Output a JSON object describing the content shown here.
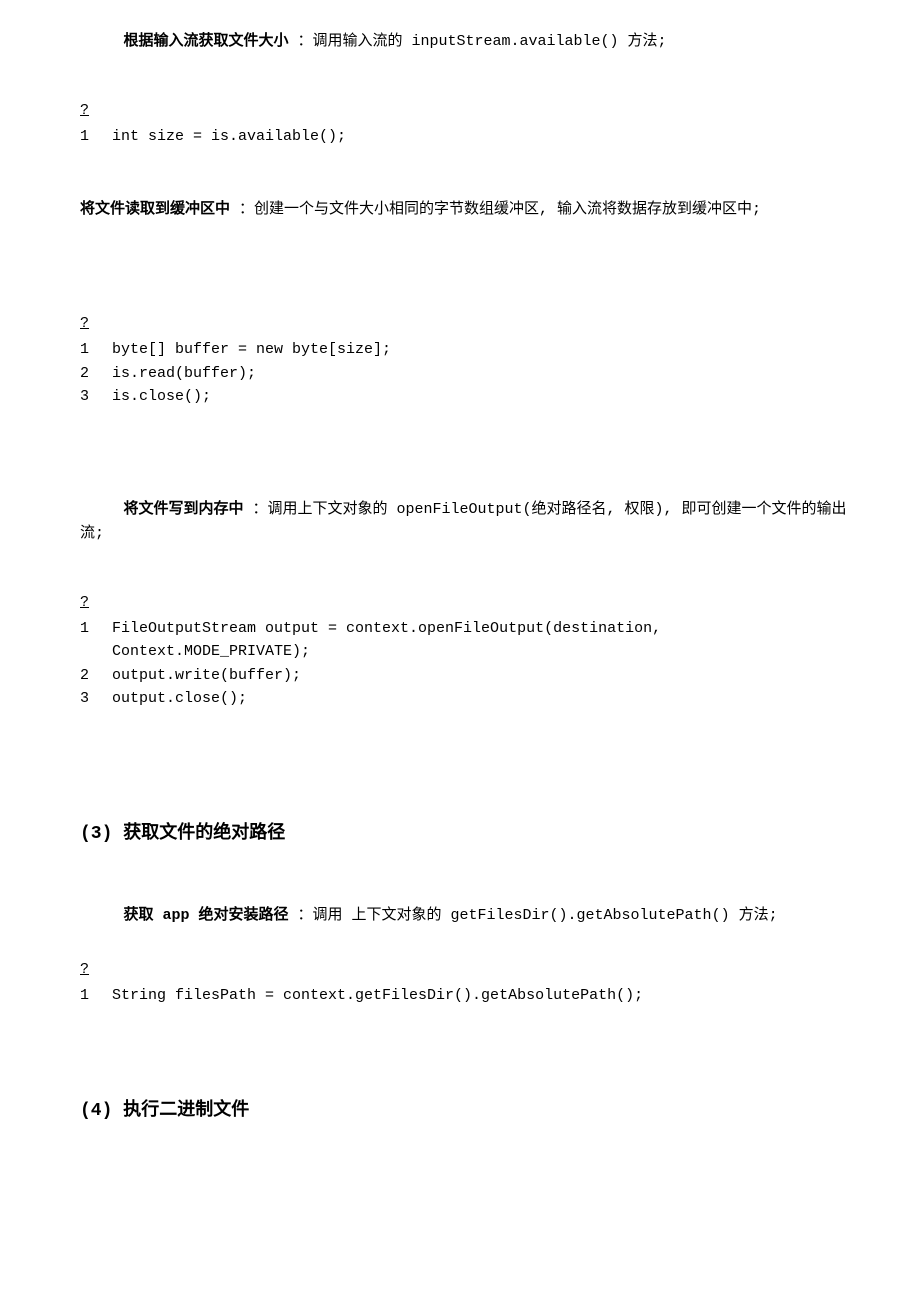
{
  "p1_bold": "根据输入流获取文件大小",
  "p1_rest": "  ：调用输入流的 inputStream.available() 方法;",
  "code1": {
    "q": "?",
    "lines": [
      {
        "no": "1",
        "text": "int size = is.available();"
      }
    ]
  },
  "p2_bold": "将文件读取到缓冲区中",
  "p2_rest": "  ：创建一个与文件大小相同的字节数组缓冲区, 输入流将数据存放到缓冲区中;",
  "code2": {
    "q": "?",
    "lines": [
      {
        "no": "1",
        "text": "byte[] buffer = new byte[size];"
      },
      {
        "no": "2",
        "text": "is.read(buffer);"
      },
      {
        "no": "3",
        "text": "is.close();"
      }
    ]
  },
  "p3_bold": "将文件写到内存中",
  "p3_rest": "  ：调用上下文对象的 openFileOutput(绝对路径名, 权限), 即可创建一个文件的输出流;",
  "code3": {
    "q": "?",
    "lines": [
      {
        "no": "1",
        "text": "FileOutputStream output = context.openFileOutput(destination, Context.MODE_PRIVATE);"
      },
      {
        "no": "2",
        "text": "output.write(buffer);"
      },
      {
        "no": "3",
        "text": "output.close();"
      }
    ]
  },
  "h3": "(3) 获取文件的绝对路径",
  "p4_bold": "获取 app 绝对安装路径",
  "p4_rest": "  ：调用 上下文对象的 getFilesDir().getAbsolutePath() 方法;",
  "code4": {
    "q": "?",
    "lines": [
      {
        "no": "1",
        "text": "String filesPath = context.getFilesDir().getAbsolutePath();"
      }
    ]
  },
  "h4": "(4) 执行二进制文件"
}
